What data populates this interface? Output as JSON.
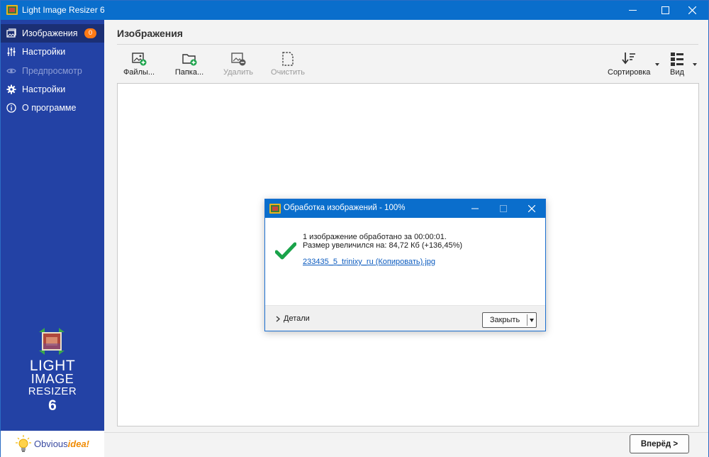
{
  "window": {
    "title": "Light Image Resizer 6",
    "accent": "#0a6ecc",
    "controls": [
      "minimize-icon",
      "maximize-icon",
      "close-icon"
    ]
  },
  "sidebar": {
    "background": "#2342a5",
    "items": [
      {
        "label": "Изображения",
        "icon": "images-icon",
        "active": true,
        "badge": "0"
      },
      {
        "label": "Настройки",
        "icon": "sliders-icon"
      },
      {
        "label": "Предпросмотр",
        "icon": "eye-icon",
        "disabled": true
      },
      {
        "label": "Настройки",
        "icon": "gear-icon"
      },
      {
        "label": "О программе",
        "icon": "info-icon"
      }
    ],
    "logo": {
      "line1": "LIGHT",
      "line2": "IMAGE",
      "line3": "RESIZER",
      "number": "6"
    },
    "brand": {
      "part1": "Obvious",
      "part2": "idea!"
    },
    "badge_color": "#ff7a14"
  },
  "main": {
    "title": "Изображения",
    "toolbar": {
      "files": "Файлы...",
      "folder": "Папка...",
      "remove": "Удалить",
      "clear": "Очистить",
      "sort": "Сортировка",
      "view": "Вид"
    },
    "next_button": "Вперёд >"
  },
  "dialog": {
    "title": "Обработка изображений - 100%",
    "line1": "1 изображение обработано за 00:00:01.",
    "line2": "Размер увеличился на: 84,72 Кб (+136,45%)",
    "link": "233435_5_trinixy_ru (Копировать).jpg",
    "details": "Детали",
    "close": "Закрыть",
    "check_color": "#1aa34a"
  }
}
